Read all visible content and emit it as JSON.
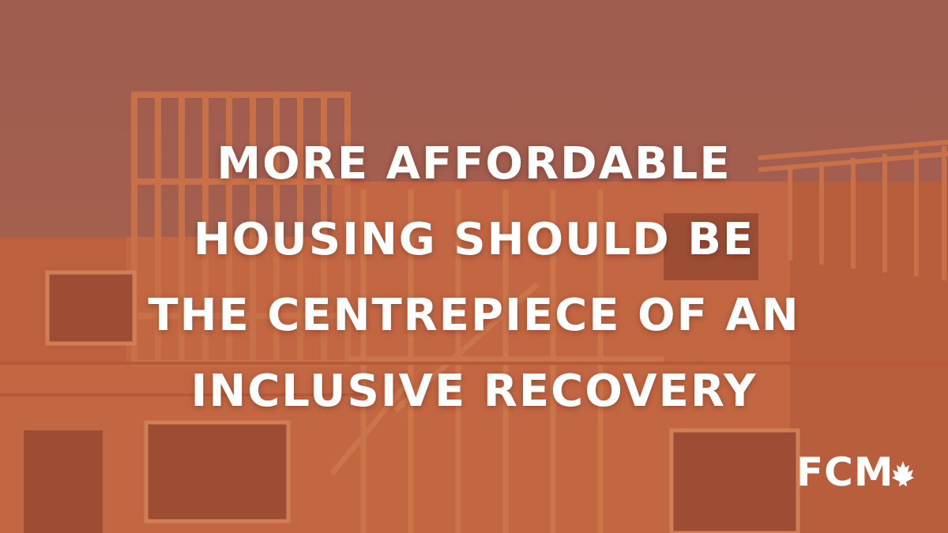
{
  "headline": {
    "lines": [
      "MORE AFFORDABLE",
      "HOUSING SHOULD BE",
      "THE CENTREPIECE OF AN",
      "INCLUSIVE RECOVERY"
    ]
  },
  "logo": {
    "text": "FCM"
  },
  "colors": {
    "overlay": "#c4613f",
    "sky": "#9a5a4e",
    "text": "#ffffff"
  },
  "icons": {
    "logo_mark": "maple-leaf-icon"
  }
}
